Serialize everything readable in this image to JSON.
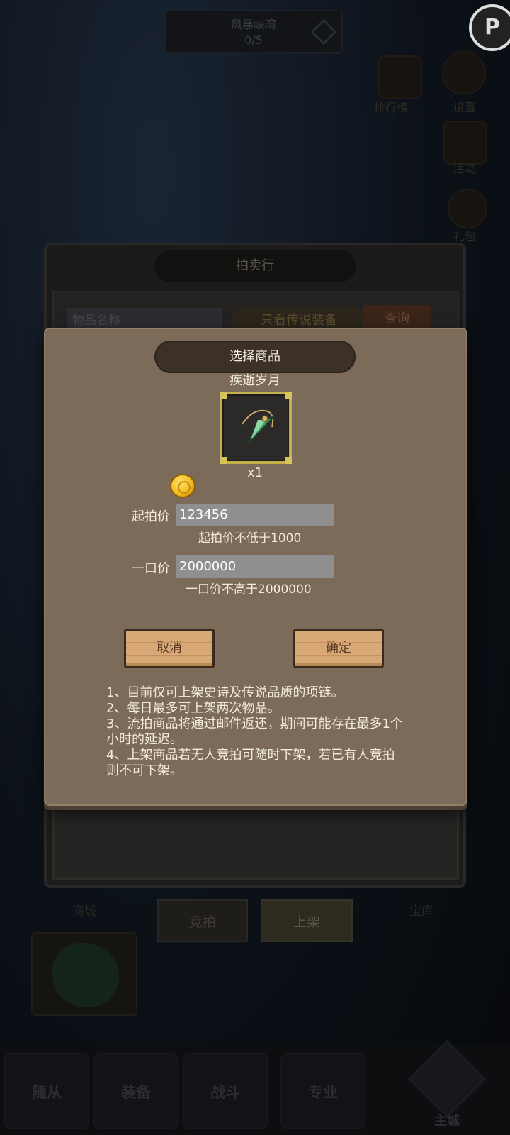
{
  "background": {
    "top_banner": {
      "title": "风暴峡湾",
      "progress": "0/5"
    },
    "corner_badge": "P",
    "side_labels": [
      "排行榜",
      "设置",
      "活动",
      "礼包"
    ],
    "auction": {
      "title": "拍卖行",
      "search_placeholder": "物品名称",
      "legend_filter": "只看传说装备",
      "query_button": "查询"
    },
    "tabs": {
      "bid": "竞拍",
      "list": "上架"
    },
    "side_tabs": [
      "商城",
      "宝库"
    ],
    "bottom_nav": [
      "随从",
      "装备",
      "战斗",
      "专业",
      "主城"
    ]
  },
  "modal": {
    "title": "选择商品",
    "item_name": "疾逝岁月",
    "item_quantity": "x1",
    "start_price_label": "起拍价",
    "start_price_value": "123456",
    "start_price_hint": "起拍价不低于1000",
    "buyout_label": "一口价",
    "buyout_value": "2000000",
    "buyout_hint": "一口价不高于2000000",
    "cancel_label": "取消",
    "confirm_label": "确定",
    "rules": [
      "1、目前仅可上架史诗及传说品质的项链。",
      "2、每日最多可上架两次物品。",
      "3、流拍商品将通过邮件返还，期间可能存在最多1个小时的延迟。",
      "4、上架商品若无人竞拍可随时下架，若已有人竞拍则不可下架。"
    ]
  },
  "colors": {
    "modal_bg": "#7b6b58",
    "header_bg": "#3b3128",
    "slot_border": "#c5b14a",
    "input_bg": "#8f8f8f",
    "wood_button": "#d8a877"
  }
}
